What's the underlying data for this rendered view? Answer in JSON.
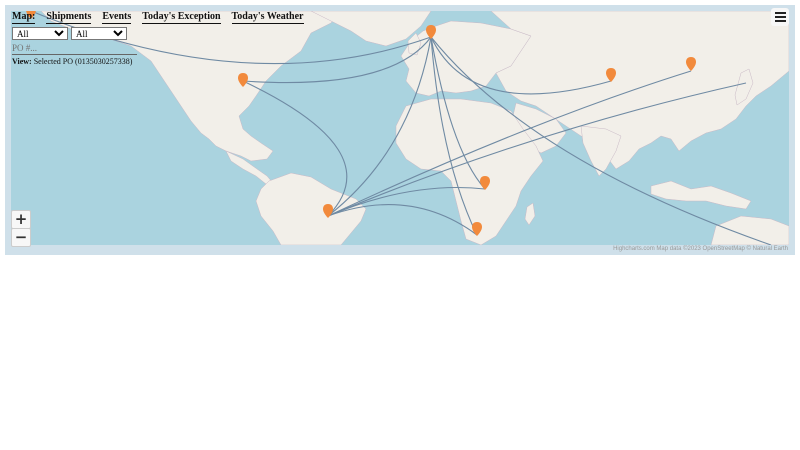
{
  "nav": {
    "map_label": "Map:",
    "tabs": [
      "Shipments",
      "Events",
      "Today's Exception",
      "Today's Weather"
    ]
  },
  "filters": {
    "filter1_value": "All",
    "filter2_value": "All",
    "po_placeholder": "PO #..."
  },
  "view": {
    "label": "View:",
    "text": "Selected PO (0135030257338)"
  },
  "zoom": {
    "in": "+",
    "out": "−"
  },
  "credits": "Highcharts.com Map data ©2023 OpenStreetMap © Natural Earth",
  "colors": {
    "ocean": "#aad3df",
    "land": "#f2efe9",
    "route": "#6f8aa3",
    "marker": "#f28a3c"
  },
  "icons": [
    "hamburger-menu-icon",
    "map-pin-icon",
    "zoom-in-icon",
    "zoom-out-icon"
  ]
}
